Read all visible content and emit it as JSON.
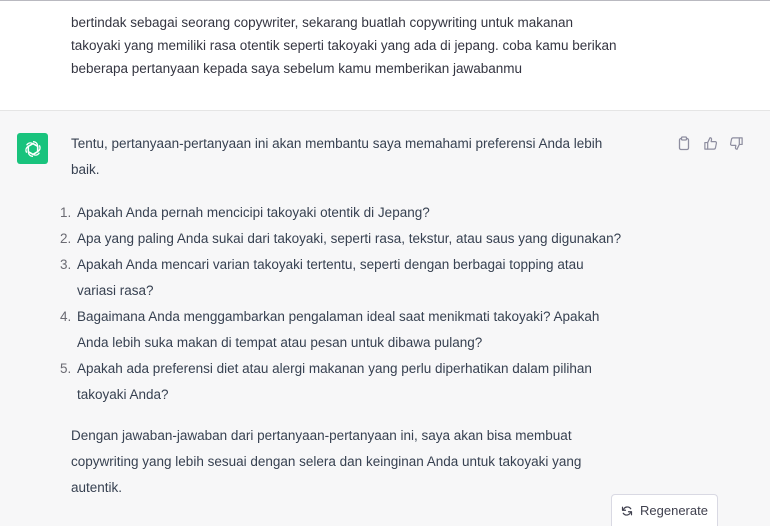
{
  "user_message": {
    "lines": [
      "bertindak sebagai seorang copywriter, sekarang buatlah copywriting untuk makanan",
      "takoyaki yang memiliki rasa otentik seperti takoyaki yang ada di jepang. coba kamu berikan",
      "beberapa pertanyaan kepada saya sebelum kamu memberikan jawabanmu"
    ]
  },
  "assistant": {
    "avatar_icon": "openai-logo-icon",
    "avatar_color": "#19c37d",
    "intro_lines": [
      "Tentu, pertanyaan-pertanyaan ini akan membantu saya memahami preferensi Anda lebih",
      "baik."
    ],
    "questions": [
      {
        "num": "1.",
        "lines": [
          "Apakah Anda pernah mencicipi takoyaki otentik di Jepang?"
        ]
      },
      {
        "num": "2.",
        "lines": [
          "Apa yang paling Anda sukai dari takoyaki, seperti rasa, tekstur, atau saus yang digunakan?"
        ]
      },
      {
        "num": "3.",
        "lines": [
          "Apakah Anda mencari varian takoyaki tertentu, seperti dengan berbagai topping atau",
          "variasi rasa?"
        ]
      },
      {
        "num": "4.",
        "lines": [
          "Bagaimana Anda menggambarkan pengalaman ideal saat menikmati takoyaki? Apakah",
          "Anda lebih suka makan di tempat atau pesan untuk dibawa pulang?"
        ]
      },
      {
        "num": "5.",
        "lines": [
          "Apakah ada preferensi diet atau alergi makanan yang perlu diperhatikan dalam pilihan",
          "takoyaki Anda?"
        ]
      }
    ],
    "outro_lines": [
      "Dengan jawaban-jawaban dari pertanyaan-pertanyaan ini, saya akan bisa membuat",
      "copywriting yang lebih sesuai dengan selera dan keinginan Anda untuk takoyaki yang",
      "autentik."
    ]
  },
  "actions": {
    "copy_icon": "clipboard-icon",
    "like_icon": "thumbs-up-icon",
    "dislike_icon": "thumbs-down-icon"
  },
  "regenerate": {
    "label": "Regenerate",
    "icon": "refresh-icon"
  }
}
